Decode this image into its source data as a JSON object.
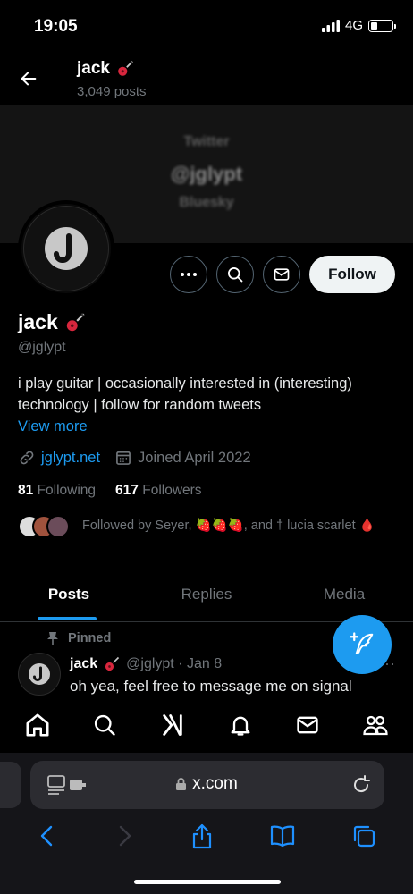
{
  "status": {
    "time": "19:05",
    "network": "4G",
    "battery_level": 0.3
  },
  "header": {
    "name": "jack",
    "posts": "3,049 posts"
  },
  "banner": {
    "lines": [
      "Twitter",
      "@jglypt",
      "Bluesky"
    ]
  },
  "actions": {
    "follow_label": "Follow"
  },
  "profile": {
    "name": "jack",
    "handle": "@jglypt",
    "bio_line1": "i play guitar | occasionally interested in (interesting)",
    "bio_line2": "technology | follow for random tweets",
    "view_more": "View more",
    "website": "jglypt.net",
    "joined": "Joined April 2022",
    "following_count": "81",
    "following_label": "Following",
    "followers_count": "617",
    "followers_label": "Followers",
    "followed_by": "Followed by Seyer, 🍓🍓🍓, and † lucia scarlet 🩸"
  },
  "tabs": [
    "Posts",
    "Replies",
    "Media"
  ],
  "tweet": {
    "pinned_label": "Pinned",
    "name": "jack",
    "handle_date": "@jglypt · Jan 8",
    "text": "oh yea, feel free to message me on signal",
    "more": "···"
  },
  "safari": {
    "url": "x.com"
  },
  "colors": {
    "accent": "#1d9bf0",
    "background": "#000000",
    "muted": "#71767b"
  },
  "icons": [
    "back-arrow-icon",
    "guitar-icon",
    "more-icon",
    "search-icon",
    "mail-icon",
    "link-icon",
    "calendar-icon",
    "pin-icon",
    "compose-icon",
    "home-icon",
    "grok-icon",
    "bell-icon",
    "people-icon",
    "reader-icon",
    "lock-icon",
    "reload-icon",
    "share-icon",
    "bookmarks-icon",
    "tabs-icon"
  ]
}
